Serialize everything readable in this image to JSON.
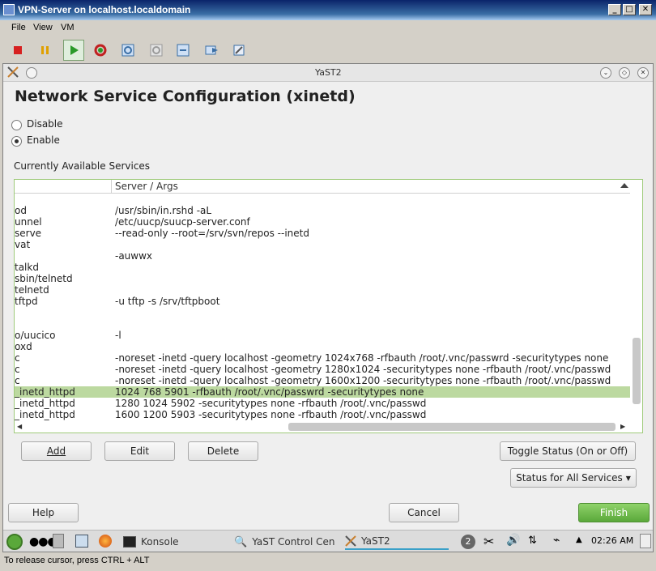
{
  "vm_window": {
    "title": "VPN-Server on localhost.localdomain",
    "menu": [
      "File",
      "View",
      "VM"
    ],
    "toolbar": [
      "stop-icon",
      "pause-icon",
      "play-icon",
      "restart-icon",
      "snapshot-icon",
      "snapshot-revert-icon",
      "snapshot-manage-icon",
      "send-key-icon",
      "settings-icon"
    ],
    "status_line": "To release cursor, press CTRL + ALT"
  },
  "yast": {
    "window_title": "YaST2",
    "page_title": "Network Service Configuration (xinetd)",
    "radio_disable": "Disable",
    "radio_enable": "Enable",
    "selected_radio": "Enable",
    "list_label": "Currently Available Services",
    "table": {
      "col_server_args": "Server / Args",
      "rows": [
        {
          "name": "",
          "args": ""
        },
        {
          "name": "od",
          "args": "/usr/sbin/in.rshd -aL"
        },
        {
          "name": "unnel",
          "args": "/etc/uucp/suucp-server.conf"
        },
        {
          "name": "serve",
          "args": "--read-only --root=/srv/svn/repos --inetd"
        },
        {
          "name": "vat",
          "args": ""
        },
        {
          "name": "",
          "args": "-auwwx"
        },
        {
          "name": "talkd",
          "args": ""
        },
        {
          "name": "sbin/telnetd",
          "args": ""
        },
        {
          "name": "telnetd",
          "args": ""
        },
        {
          "name": "tftpd",
          "args": "-u tftp -s /srv/tftpboot"
        },
        {
          "name": "",
          "args": ""
        },
        {
          "name": "",
          "args": ""
        },
        {
          "name": "o/uucico",
          "args": "-l"
        },
        {
          "name": "oxd",
          "args": ""
        },
        {
          "name": "c",
          "args": "-noreset -inetd -query localhost -geometry 1024x768 -rfbauth /root/.vnc/passwrd -securitytypes none"
        },
        {
          "name": "c",
          "args": "-noreset -inetd -query localhost -geometry 1280x1024 -securitytypes none -rfbauth /root/.vnc/passwd"
        },
        {
          "name": "c",
          "args": "-noreset -inetd -query localhost -geometry 1600x1200 -securitytypes none -rfbauth /root/.vnc/passwd"
        },
        {
          "name": "_inetd_httpd",
          "args": "1024 768 5901  -rfbauth /root/.vnc/passwrd -securitytypes none"
        },
        {
          "name": "_inetd_httpd",
          "args": "1280 1024 5902 -securitytypes none -rfbauth /root/.vnc/passwd"
        },
        {
          "name": "_inetd_httpd",
          "args": "1600 1200 5903 -securitytypes none -rfbauth /root/.vnc/passwd"
        }
      ],
      "selected_row": 17
    },
    "buttons": {
      "add": "Add",
      "edit": "Edit",
      "delete": "Delete",
      "toggle_status": "Toggle Status (On or Off)",
      "status_all": "Status for All Services",
      "help": "Help",
      "cancel": "Cancel",
      "finish": "Finish"
    }
  },
  "panel": {
    "tasks": [
      {
        "label": "Konsole",
        "icon": "konsole-icon"
      },
      {
        "label": "YaST Control Cen",
        "icon": "yast-control-center-icon"
      },
      {
        "label": "YaST2",
        "icon": "yast-icon"
      }
    ],
    "desktop_number": "2",
    "clock": "02:26 AM"
  },
  "colors": {
    "selection": "#bcd9a0",
    "finish_button": "#5aa83a",
    "vm_title_bar": "#0a246a"
  }
}
